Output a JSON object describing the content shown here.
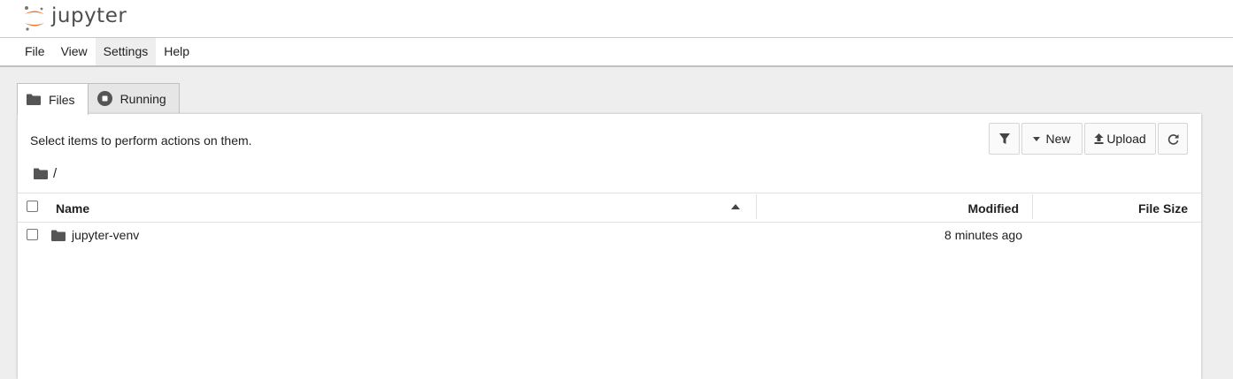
{
  "app": {
    "logo_text": "jupyter"
  },
  "menu": [
    {
      "label": "File"
    },
    {
      "label": "View"
    },
    {
      "label": "Settings"
    },
    {
      "label": "Help"
    }
  ],
  "tabs": [
    {
      "label": "Files",
      "icon": "folder-icon",
      "active": true
    },
    {
      "label": "Running",
      "icon": "stop-circle-icon",
      "active": false
    }
  ],
  "status_text": "Select items to perform actions on them.",
  "toolbar": {
    "new_label": "New",
    "upload_label": "Upload"
  },
  "breadcrumb": {
    "path": "/"
  },
  "table": {
    "columns": {
      "name": "Name",
      "modified": "Modified",
      "file_size": "File Size"
    },
    "rows": [
      {
        "name": "jupyter-venv",
        "modified": "8 minutes ago",
        "file_size": "",
        "type": "folder"
      }
    ]
  },
  "colors": {
    "logo_orange": "#F37626",
    "text": "#212121",
    "icon_gray": "#555555"
  }
}
